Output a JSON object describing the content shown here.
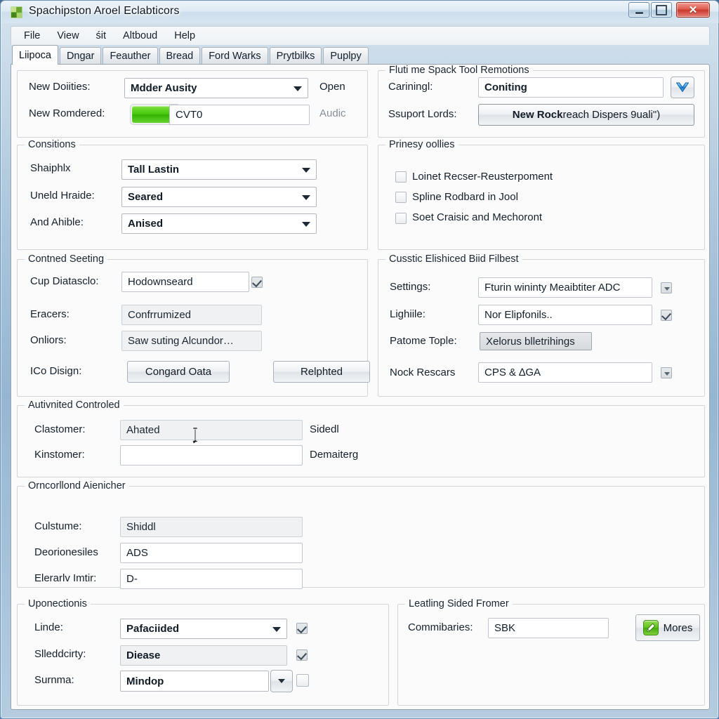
{
  "window": {
    "title": "Spachipston Aroel Eclabticors",
    "icon": "app-grid-icon",
    "controls": {
      "minimize": "minimize-icon",
      "maximize": "maximize-icon",
      "close": "✕"
    }
  },
  "menubar": {
    "items": [
      "File",
      "View",
      "śit",
      "Altboud",
      "Help"
    ]
  },
  "tabs": [
    {
      "label": "Liipoca",
      "active": true
    },
    {
      "label": "Dngar",
      "active": false
    },
    {
      "label": "Feauther",
      "active": false
    },
    {
      "label": "Bread",
      "active": false
    },
    {
      "label": "Ford Warks",
      "active": false
    },
    {
      "label": "Prytbilks",
      "active": false
    },
    {
      "label": "Puplpy",
      "active": false
    }
  ],
  "top_left": {
    "row1": {
      "label": "New Doiities:",
      "combo_value": "Mdder Ausity",
      "trailing": "Open"
    },
    "row2": {
      "label": "New Romdered:",
      "swatch_color": "#46c80c",
      "field_value": "CVT0",
      "trailing": "Audic"
    }
  },
  "top_right": {
    "legend": "Fluti me Spack Tool Remotions",
    "row1": {
      "label": "Cariningl:",
      "field_value": "Coniting",
      "icon": "blue-chevron-icon"
    },
    "row2": {
      "label": "Ssuport Lords:",
      "button_bold": "New Rock",
      "button_rest": " reach Dispers 9uali\")"
    }
  },
  "consitions": {
    "legend": "Consitions",
    "rows": [
      {
        "label": "Shaiphlx",
        "value": "Tall Lastin"
      },
      {
        "label": "Uneld Hraide:",
        "value": "Seared"
      },
      {
        "label": "And Ahible:",
        "value": "Anised"
      }
    ]
  },
  "prinesy": {
    "legend": "Prinesy oollies",
    "checks": [
      {
        "label": "Loinet Recser-Reusterpoment",
        "checked": false
      },
      {
        "label": "Spline Rodbard in Jool",
        "checked": false
      },
      {
        "label": "Soet Craisic and Mechoront",
        "checked": false
      }
    ]
  },
  "contned": {
    "legend": "Contned Seeting",
    "row1": {
      "label": "Cup Diatasclo:",
      "value": "Hodownseard",
      "checked": true
    },
    "row2": {
      "label": "Eracers:",
      "value": "Confrrumized"
    },
    "row3": {
      "label": "Onliors:",
      "value": "Saw suting Alcundor…"
    },
    "row4": {
      "label": "ICo Disign:",
      "button1": "Congard Oata",
      "button2": "Relphted"
    }
  },
  "cusstic": {
    "legend": "Cusstic Elishiced Biid Filbest",
    "row1": {
      "label": "Settings:",
      "value": "Fturin wininty Meaibtiter ADC",
      "affordance": "dropdown"
    },
    "row2": {
      "label": "Lighiile:",
      "value": "Nor Elipfonils..",
      "affordance": "checkbox",
      "checked": true
    },
    "row3": {
      "label": "Patome Tople:",
      "value": "Xelorus blletrihings"
    },
    "row4": {
      "label": "Nock Rescars",
      "value": "CPS & ∆GA",
      "affordance": "dropdown"
    }
  },
  "autivnited": {
    "legend": "Autivnited Controled",
    "rows": [
      {
        "label": "Clastomer:",
        "value": "Ahated",
        "trailing": "Sidedl",
        "readonly": true
      },
      {
        "label": "Kinstomer:",
        "value": "",
        "trailing": "Demaiterg",
        "readonly": false
      }
    ]
  },
  "orncorllond": {
    "legend": "Orncorllond Aienicher",
    "rows": [
      {
        "label": "Culstume:",
        "value": "Shiddl",
        "readonly": true
      },
      {
        "label": "Deorionesiles",
        "value": "ADS",
        "readonly": false
      },
      {
        "label": "Elerarlv Imtir:",
        "value": "D-",
        "readonly": false
      }
    ]
  },
  "uponectionis": {
    "legend": "Uponectionis",
    "rows": [
      {
        "label": "Linde:",
        "value": "Pafaciided",
        "type": "combo",
        "checked": true
      },
      {
        "label": "Slleddcirty:",
        "value": "Diease",
        "type": "flat",
        "checked": true
      },
      {
        "label": "Surnma:",
        "value": "Mindop",
        "type": "split",
        "checked": false
      }
    ]
  },
  "leatling": {
    "legend": "Leatling Sided Fromer",
    "label": "Commibaries:",
    "value": "SBK",
    "button": {
      "label": "Mores",
      "icon": "green-pencil-icon"
    }
  },
  "colors": {
    "accent_green": "#46c80c",
    "accent_blue": "#1c86d6",
    "close_red": "#c8392c",
    "window_glass": "#b0c9de"
  }
}
